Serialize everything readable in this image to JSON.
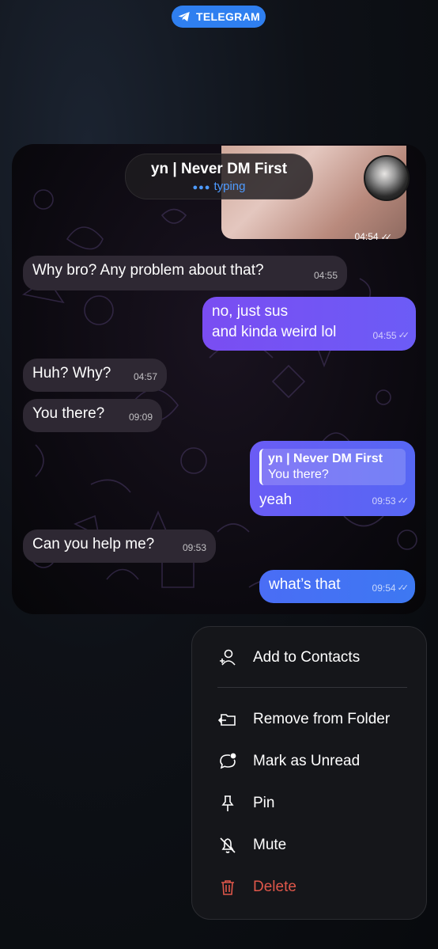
{
  "app_badge": {
    "label": "TELEGRAM",
    "icon": "telegram-icon",
    "color": "#2f7ff0"
  },
  "chat": {
    "title": "yn | Never DM First",
    "status": "typing",
    "photo_time": "04:54",
    "messages": [
      {
        "dir": "in",
        "text": "Why bro? Any problem about that?",
        "time": "04:55"
      },
      {
        "dir": "out",
        "line1": "no, just sus",
        "line2": "and kinda weird lol",
        "time": "04:55"
      },
      {
        "dir": "in",
        "text": "Huh? Why?",
        "time": "04:57"
      },
      {
        "dir": "in",
        "text": "You there?",
        "time": "09:09"
      },
      {
        "dir": "out",
        "reply_name": "yn | Never DM First",
        "reply_text": "You there?",
        "text": "yeah",
        "time": "09:53"
      },
      {
        "dir": "in",
        "text": "Can you help me?",
        "time": "09:53"
      },
      {
        "dir": "out",
        "text": "what’s that",
        "time": "09:54"
      }
    ]
  },
  "menu": {
    "items": [
      {
        "label": "Add to Contacts",
        "icon": "add-contact-icon"
      },
      {
        "label": "Remove from Folder",
        "icon": "folder-remove-icon"
      },
      {
        "label": "Mark as Unread",
        "icon": "chat-unread-icon"
      },
      {
        "label": "Pin",
        "icon": "pin-icon"
      },
      {
        "label": "Mute",
        "icon": "bell-mute-icon"
      },
      {
        "label": "Delete",
        "icon": "trash-icon",
        "color": "#e0574a"
      }
    ]
  }
}
